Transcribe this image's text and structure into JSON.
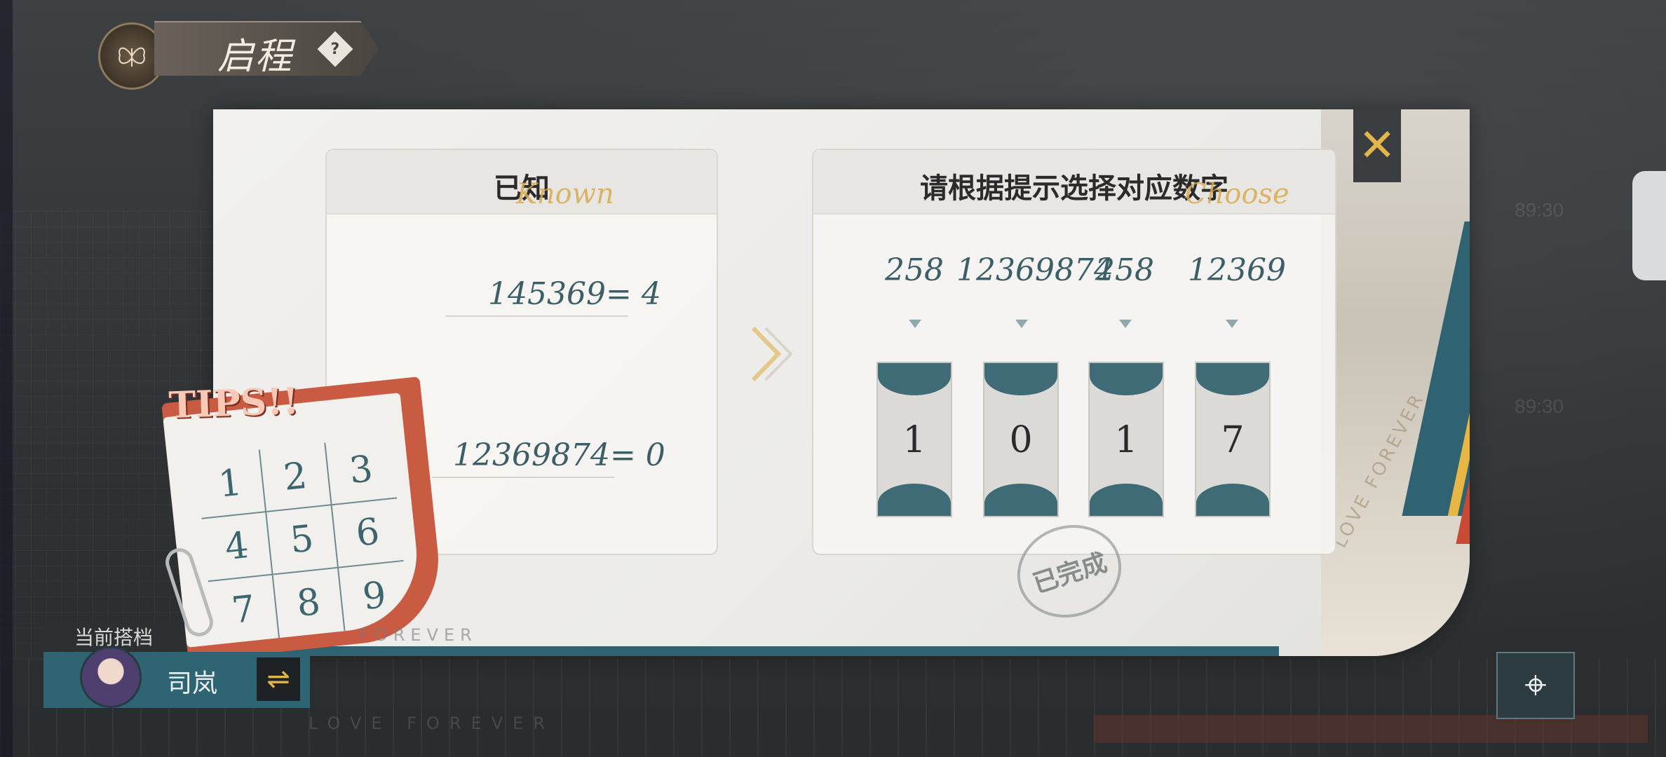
{
  "header": {
    "title": "启程",
    "help_icon": "?"
  },
  "dialog": {
    "close_icon": "✕",
    "known": {
      "title": "已知",
      "script": "Known",
      "equations": [
        "145369= 4",
        "12369874= 0"
      ]
    },
    "choose": {
      "title": "请根据提示选择对应数字",
      "script": "Choose",
      "hints": [
        "258",
        "12369874",
        "258",
        "12369"
      ],
      "slots": [
        "1",
        "0",
        "1",
        "7"
      ]
    },
    "stamp": "已完成",
    "vertical_text": "LOVE FOREVER"
  },
  "tips": {
    "title": "TIPS!!",
    "grid": [
      "1",
      "2",
      "3",
      "4",
      "5",
      "6",
      "7",
      "8",
      "9"
    ]
  },
  "partner": {
    "label": "当前搭档",
    "name": "司岚",
    "swap_icon": "⇌"
  },
  "background": {
    "times": [
      "89:30",
      "89:30"
    ],
    "bottom_text": "LOVE FOREVER",
    "small_text": "FOREVER"
  },
  "map_icon": "⌖",
  "colors": {
    "teal": "#2f6371",
    "accent_gold": "#e3b64a",
    "tips_red": "#c85b42"
  }
}
